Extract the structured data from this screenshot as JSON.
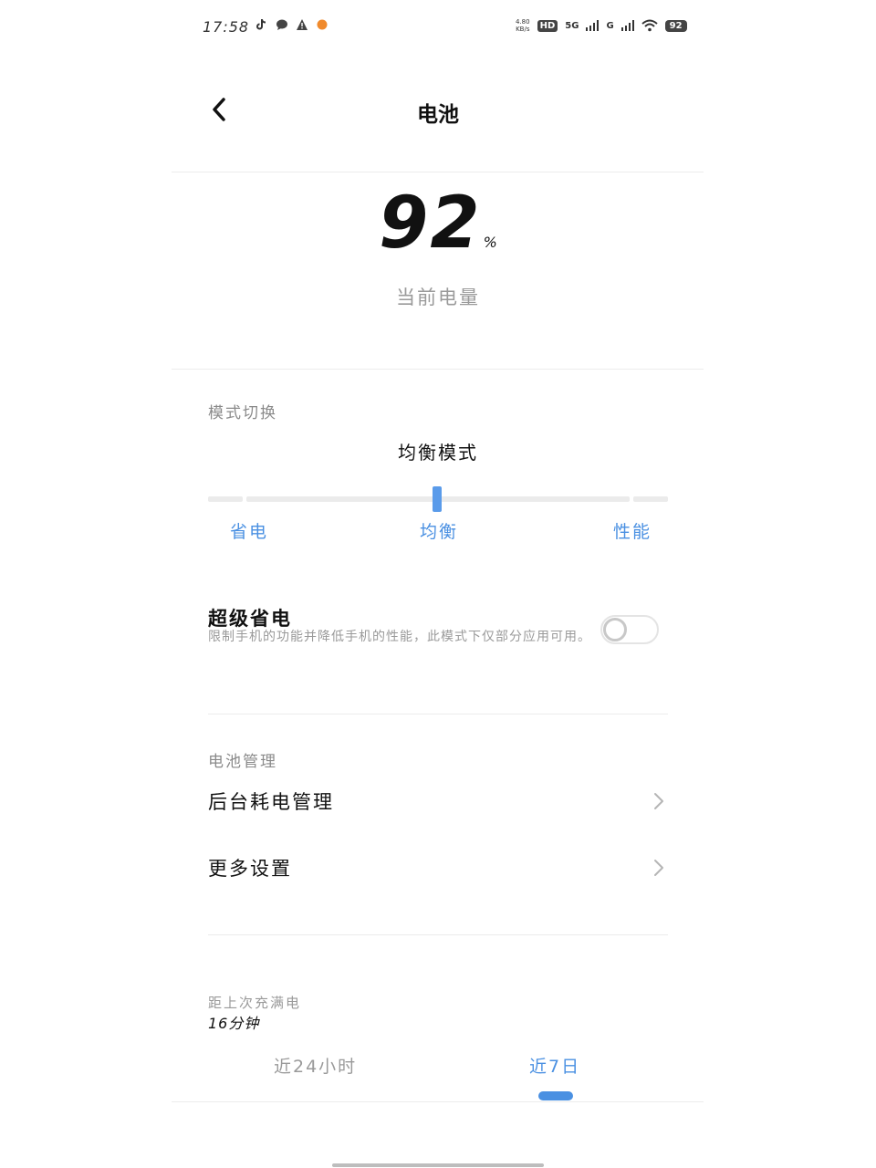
{
  "status_bar": {
    "time": "17:58",
    "net_speed_top": "4.80",
    "net_speed_bottom": "KB/s",
    "hd_label": "HD",
    "network_1": "5G",
    "network_2": "G",
    "battery_level": "92",
    "left_icons": [
      "tiktok-icon",
      "chat-icon",
      "warning-icon",
      "orange-dot-icon"
    ]
  },
  "header": {
    "title": "电池"
  },
  "battery": {
    "level": "92",
    "unit": "%",
    "label": "当前电量"
  },
  "mode": {
    "section_label": "模式切换",
    "current": "均衡模式",
    "options": [
      "省电",
      "均衡",
      "性能"
    ],
    "selected_index": 1
  },
  "super_saver": {
    "title": "超级省电",
    "description": "限制手机的功能并降低手机的性能，此模式下仅部分应用可用。",
    "enabled": false
  },
  "management": {
    "section_label": "电池管理",
    "items": [
      {
        "label": "后台耗电管理"
      },
      {
        "label": "更多设置"
      }
    ]
  },
  "since_full_charge": {
    "label": "距上次充满电",
    "value": "16分钟"
  },
  "tabs": {
    "items": [
      "近24小时",
      "近7日"
    ],
    "selected_index": 1
  },
  "colors": {
    "accent": "#4a90e2",
    "muted_text": "#9a9a9a",
    "divider": "#ececec"
  }
}
